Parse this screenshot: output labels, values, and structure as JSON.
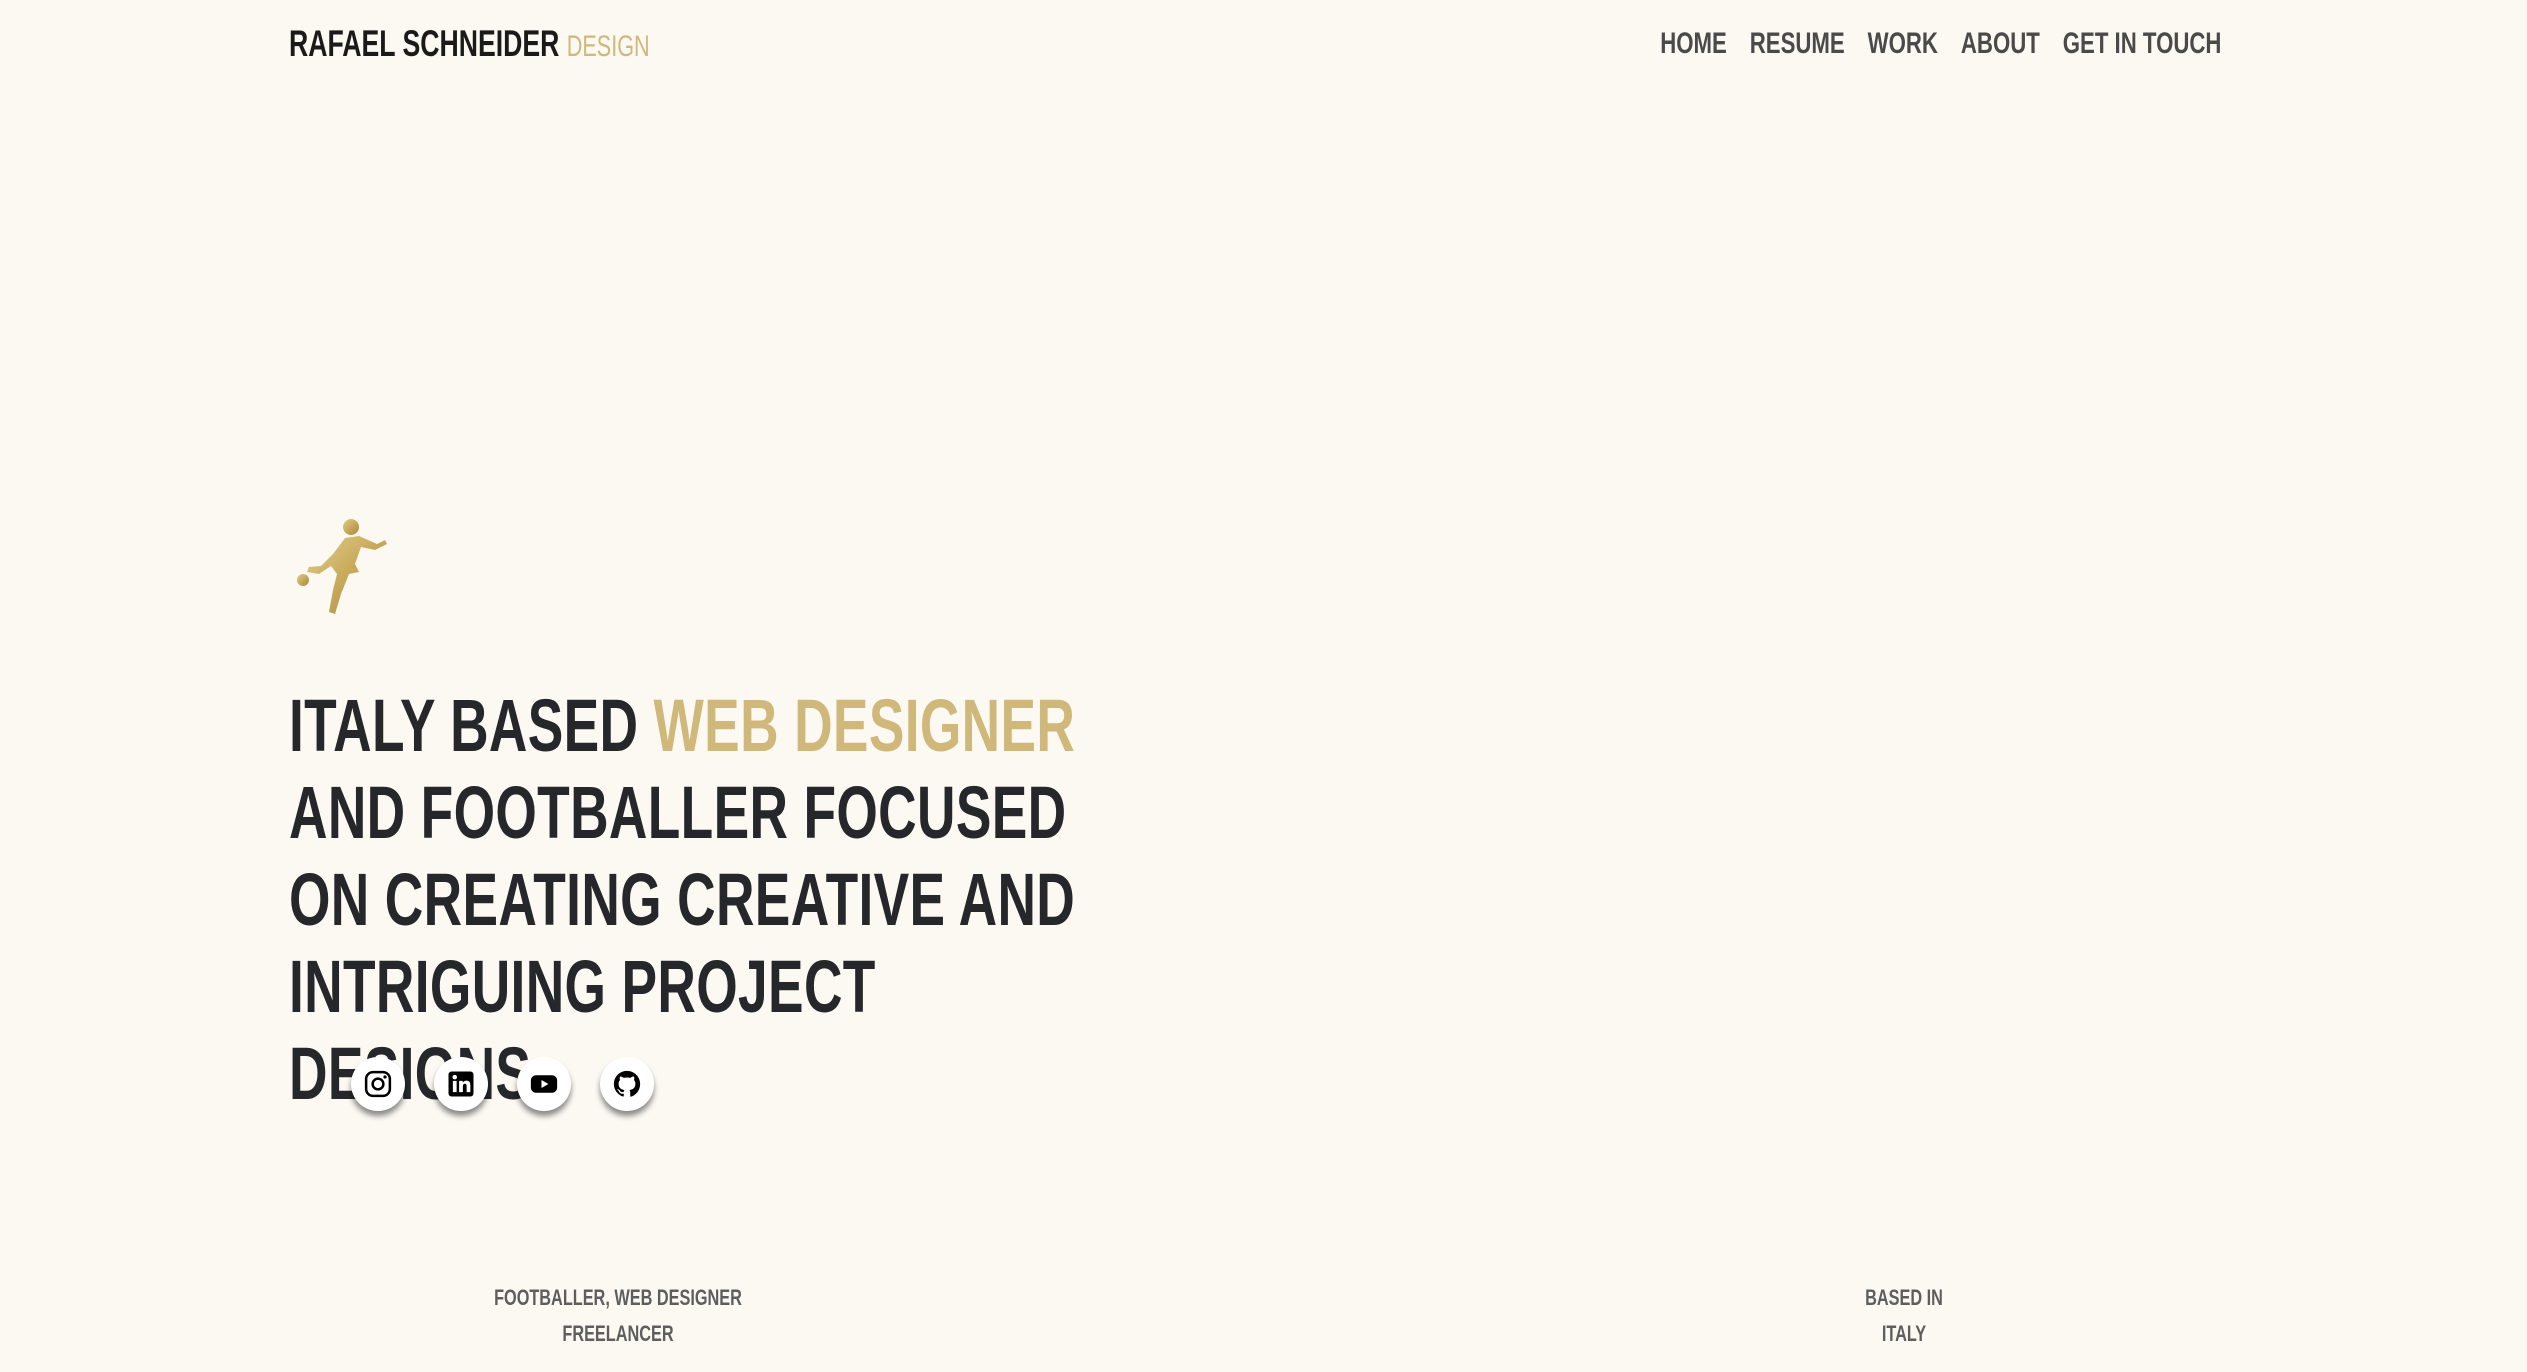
{
  "header": {
    "brand_name": "RAFAEL SCHNEIDER",
    "brand_accent": "DESIGN",
    "nav": [
      {
        "label": "HOME"
      },
      {
        "label": "RESUME"
      },
      {
        "label": "WORK"
      },
      {
        "label": "ABOUT"
      },
      {
        "label": "GET IN TOUCH"
      }
    ]
  },
  "hero": {
    "logo_icon": "footballer-kicking-icon",
    "headline_part1": "ITALY BASED ",
    "headline_highlight": "WEB DESIGNER",
    "headline_part2": " AND FOOTBALLER FOCUSED ON CREATING CREATIVE AND INTRIGUING PROJECT DESIGNS."
  },
  "socials": [
    {
      "icon": "instagram-icon"
    },
    {
      "icon": "linkedin-icon"
    },
    {
      "icon": "youtube-icon"
    },
    {
      "icon": "github-icon"
    }
  ],
  "footer": {
    "left_line1": "FOOTBALLER, WEB DESIGNER",
    "left_line2": "FREELANCER",
    "right_line1": "BASED IN",
    "right_line2": "ITALY"
  },
  "colors": {
    "background": "#fcf9f3",
    "accent": "#cfb87a",
    "text_dark": "#25272b",
    "nav_text": "#4a4a4a"
  }
}
